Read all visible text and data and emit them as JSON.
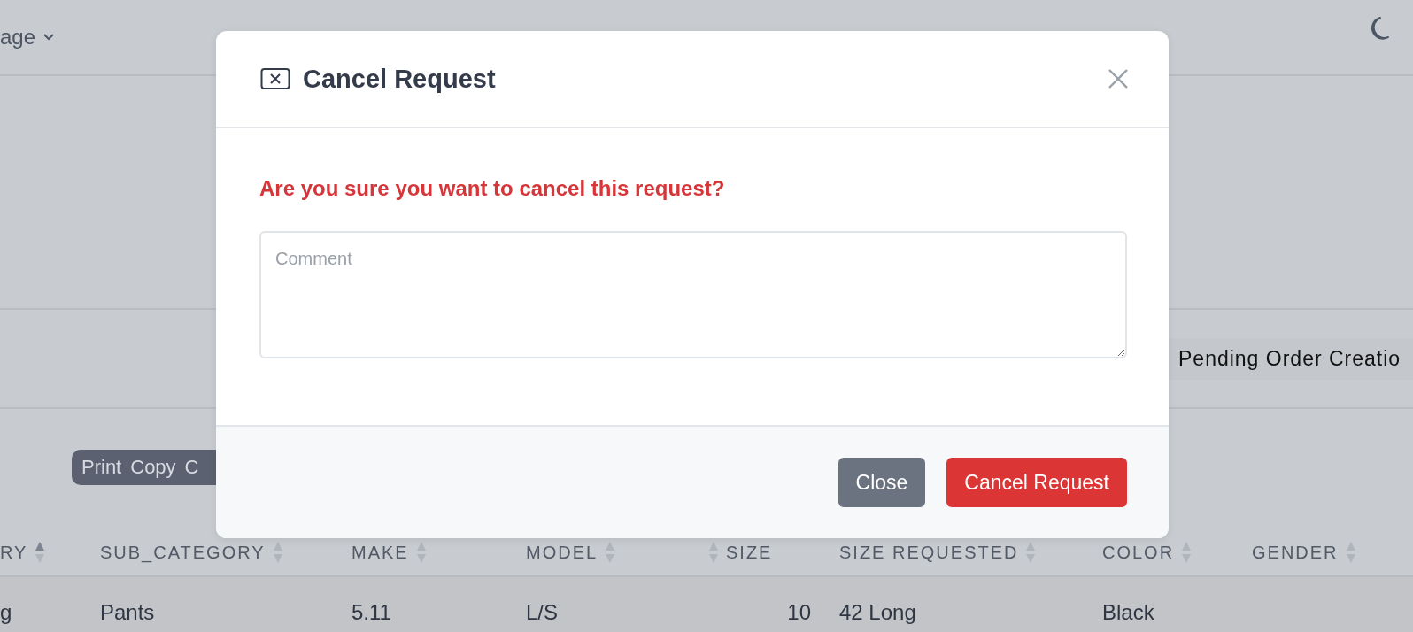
{
  "topbar": {
    "menu_label": "age"
  },
  "status_badge": "Pending Order Creatio",
  "toolbar": {
    "buttons": [
      "Print",
      "Copy",
      "C"
    ]
  },
  "table": {
    "columns": [
      {
        "label": "RY",
        "sorted_ascending": true,
        "kind": "text"
      },
      {
        "label": "SUB_CATEGORY",
        "sorted_ascending": false,
        "kind": "text"
      },
      {
        "label": "MAKE",
        "sorted_ascending": false,
        "kind": "text"
      },
      {
        "label": "MODEL",
        "sorted_ascending": false,
        "kind": "text"
      },
      {
        "label": "SIZE",
        "sorted_ascending": false,
        "kind": "number"
      },
      {
        "label": "SIZE REQUESTED",
        "sorted_ascending": false,
        "kind": "text"
      },
      {
        "label": "COLOR",
        "sorted_ascending": false,
        "kind": "text"
      },
      {
        "label": "GENDER",
        "sorted_ascending": false,
        "kind": "text"
      }
    ],
    "rows": [
      {
        "cells": [
          "g",
          "Pants",
          "5.11",
          "L/S",
          "10",
          "42 Long",
          "Black"
        ]
      }
    ]
  },
  "modal": {
    "title": "Cancel Request",
    "message": "Are you sure you want to cancel this request?",
    "comment": {
      "placeholder": "Comment"
    },
    "buttons": [
      {
        "label": "Close",
        "kind": "secondary"
      },
      {
        "label": "Cancel Request",
        "kind": "danger"
      }
    ]
  }
}
